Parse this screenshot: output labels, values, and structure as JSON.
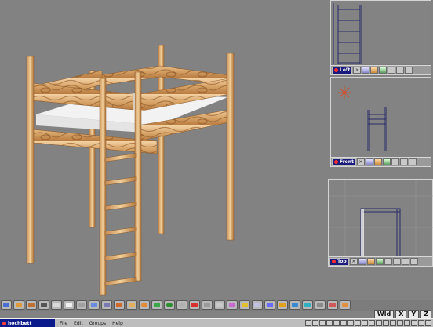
{
  "viewports": {
    "left": {
      "label": "Left"
    },
    "front": {
      "label": "Front"
    },
    "top": {
      "label": "Top"
    }
  },
  "axis_buttons": [
    "Wld",
    "X",
    "Y",
    "Z"
  ],
  "taskbar": {
    "app_title": "hochbett",
    "menu": [
      "File",
      "Edit",
      "Groups",
      "Help"
    ]
  }
}
